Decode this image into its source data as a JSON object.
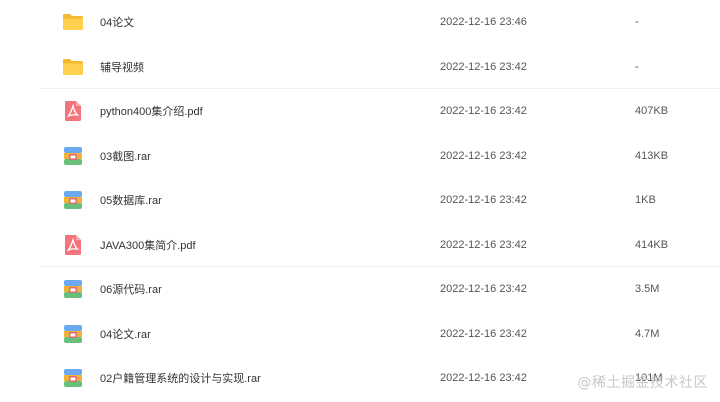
{
  "files": [
    {
      "icon": "folder-icon",
      "name": "04论文",
      "modified": "2022-12-16 23:46",
      "size": "-"
    },
    {
      "icon": "folder-icon",
      "name": "辅导视频",
      "modified": "2022-12-16 23:42",
      "size": "-"
    },
    {
      "icon": "pdf-file-icon",
      "name": "python400集介绍.pdf",
      "modified": "2022-12-16 23:42",
      "size": "407KB"
    },
    {
      "icon": "archive-file-icon",
      "name": "03截图.rar",
      "modified": "2022-12-16 23:42",
      "size": "413KB"
    },
    {
      "icon": "archive-file-icon",
      "name": "05数据库.rar",
      "modified": "2022-12-16 23:42",
      "size": "1KB"
    },
    {
      "icon": "pdf-file-icon",
      "name": "JAVA300集简介.pdf",
      "modified": "2022-12-16 23:42",
      "size": "414KB"
    },
    {
      "icon": "archive-file-icon",
      "name": "06源代码.rar",
      "modified": "2022-12-16 23:42",
      "size": "3.5M"
    },
    {
      "icon": "archive-file-icon",
      "name": "04论文.rar",
      "modified": "2022-12-16 23:42",
      "size": "4.7M"
    },
    {
      "icon": "archive-file-icon",
      "name": "02户籍管理系统的设计与实现.rar",
      "modified": "2022-12-16 23:42",
      "size": "101M"
    }
  ],
  "watermark": "@稀土掘金技术社区"
}
